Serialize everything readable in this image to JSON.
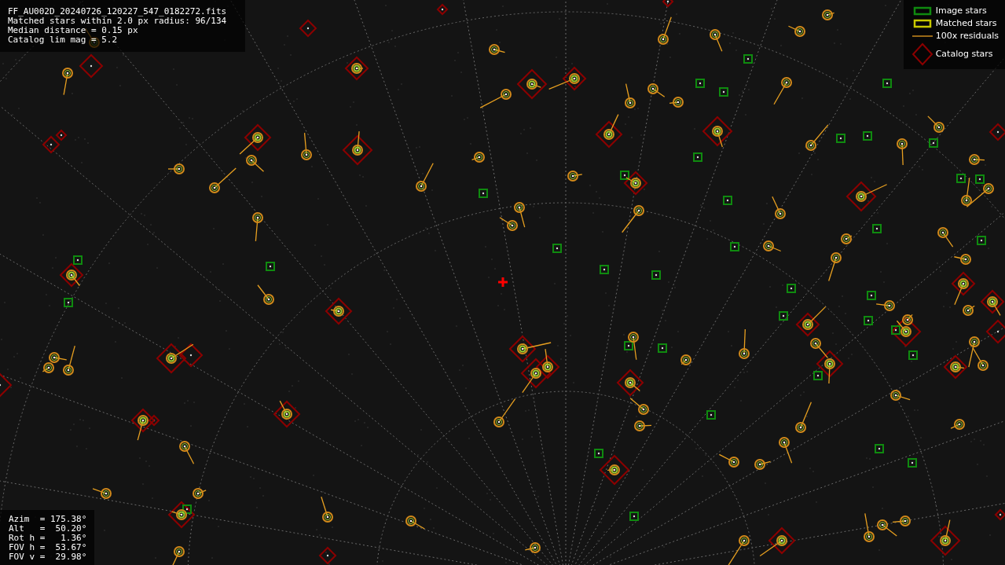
{
  "info": {
    "lines": [
      "FF_AU002D_20240726_120227_547_0182272.fits",
      "Matched stars within 2.0 px radius: 96/134",
      "Median distance = 0.15 px",
      "Catalog lim mag = 5.2"
    ]
  },
  "legend": [
    {
      "kind": "image",
      "label": "Image stars"
    },
    {
      "kind": "matched",
      "label": "Matched stars"
    },
    {
      "kind": "residual",
      "label": "100x residuals"
    },
    {
      "kind": "catalog",
      "label": "Catalog stars"
    }
  ],
  "pointing": {
    "lines": [
      "Azim  = 175.38°",
      "Alt   =  50.20°",
      "Rot h =   1.36°",
      "FOV h =  53.67°",
      "FOV v =  29.98°"
    ]
  }
}
